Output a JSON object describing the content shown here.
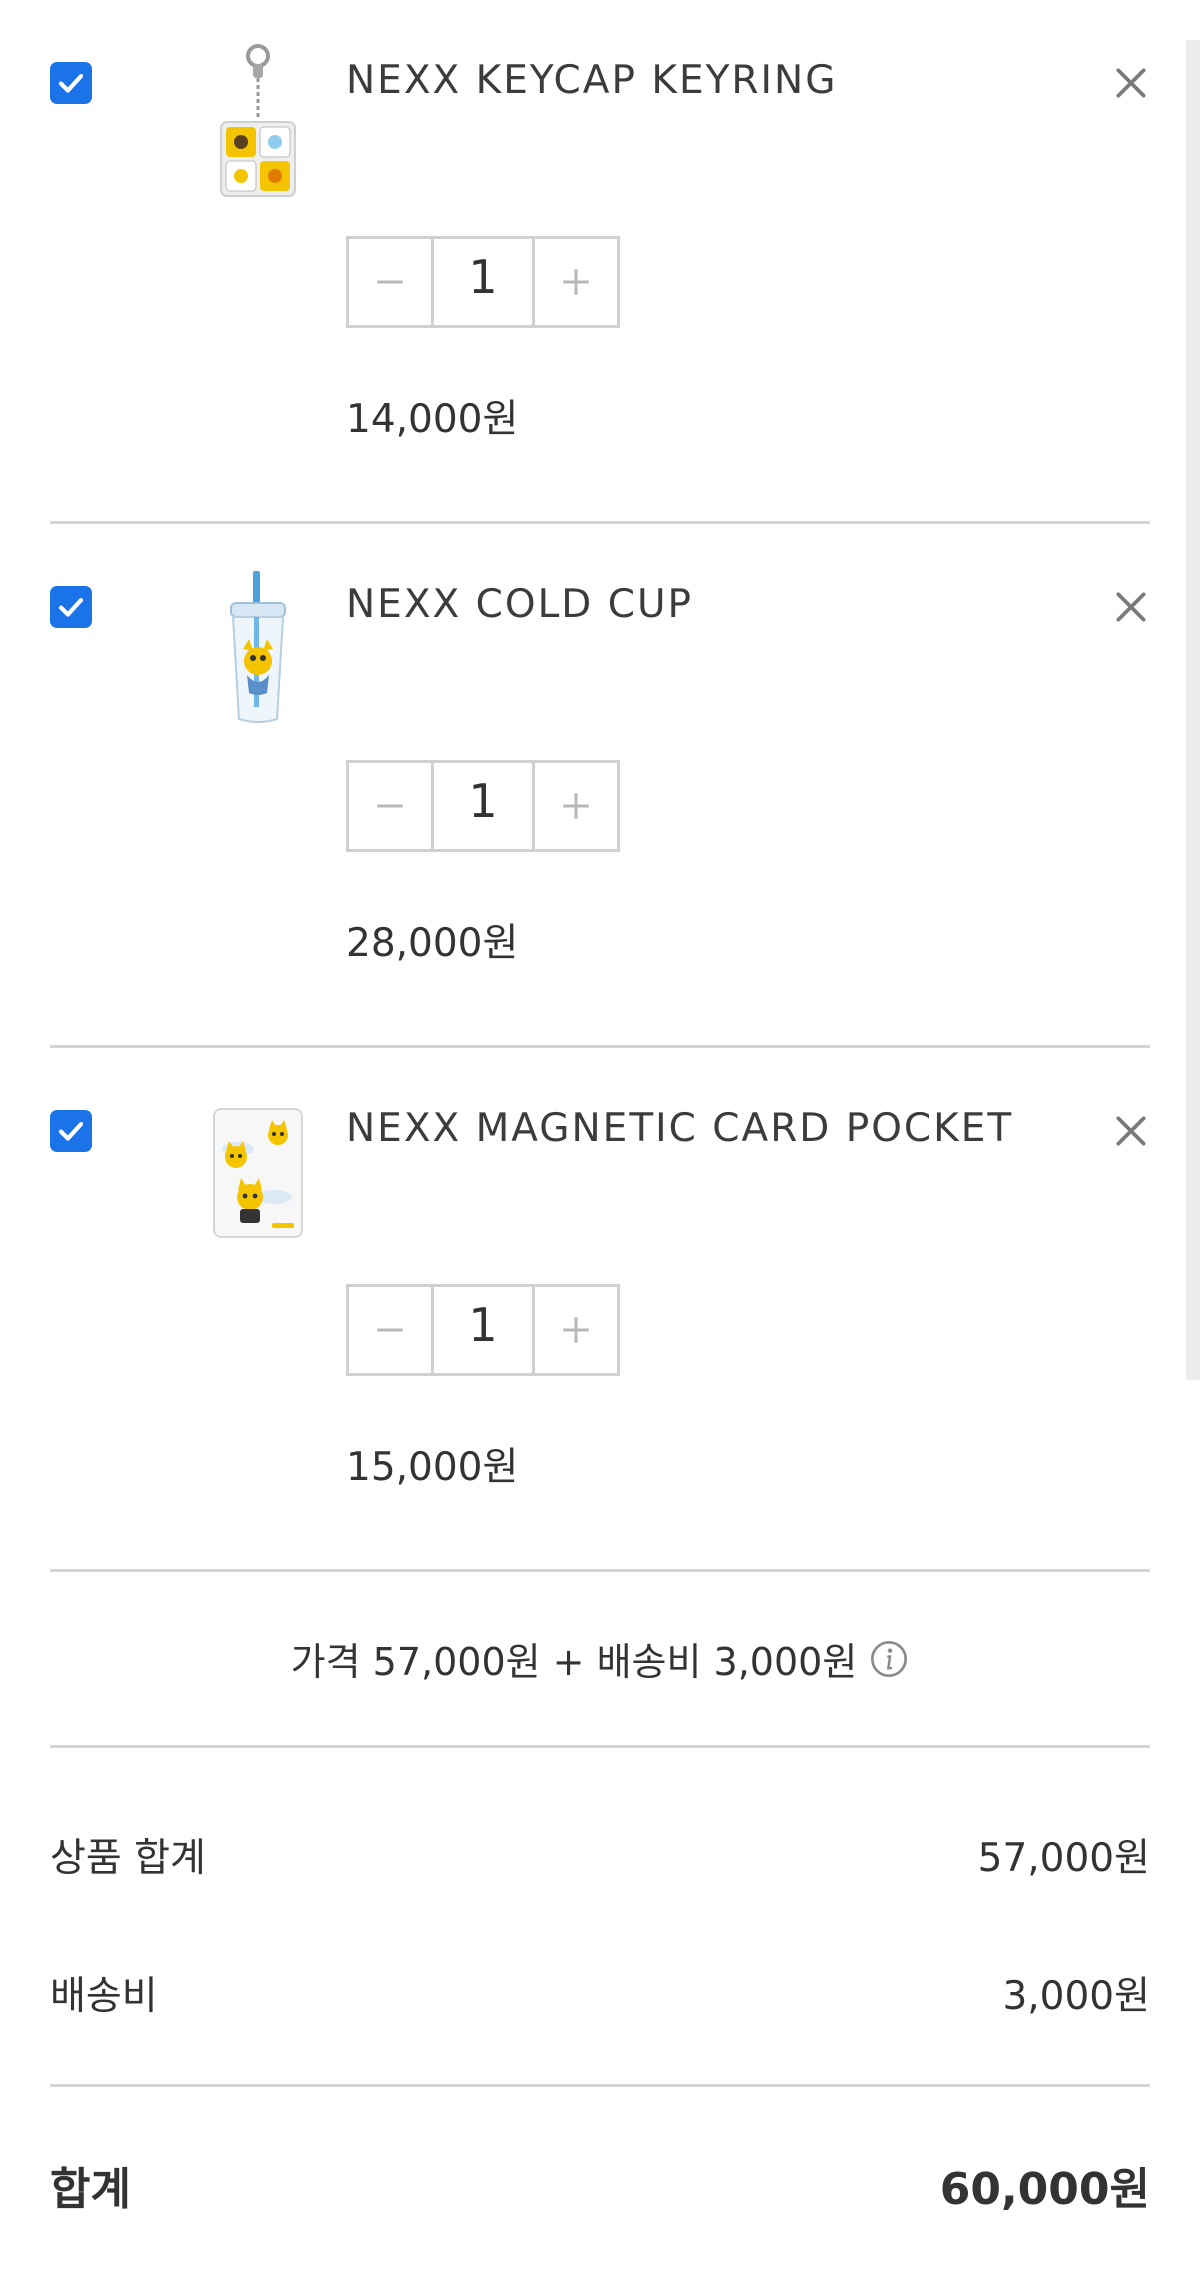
{
  "cart": {
    "items": [
      {
        "name": "NEXX KEYCAP KEYRING",
        "quantity": "1",
        "price": "14,000원",
        "checked": true,
        "thumbnail": "keyring-image"
      },
      {
        "name": "NEXX COLD CUP",
        "quantity": "1",
        "price": "28,000원",
        "checked": true,
        "thumbnail": "cold-cup-image"
      },
      {
        "name": "NEXX MAGNETIC CARD POCKET",
        "quantity": "1",
        "price": "15,000원",
        "checked": true,
        "thumbnail": "card-pocket-image"
      }
    ]
  },
  "summary": {
    "price_line": "가격 57,000원 + 배송비 3,000원",
    "subtotal_label": "상품 합계",
    "subtotal_value": "57,000원",
    "shipping_label": "배송비",
    "shipping_value": "3,000원",
    "total_label": "합계",
    "total_value": "60,000원"
  },
  "colors": {
    "checkbox": "#1a73e8",
    "divider": "#d4d4d4",
    "text": "#333333",
    "stepper_border": "#d0d0d0",
    "stepper_icon": "#b8b8b8",
    "remove_icon": "#7a7a7a"
  },
  "icons": {
    "check": "checkmark-icon",
    "remove": "close-icon",
    "decrease": "minus-icon",
    "increase": "plus-icon",
    "info": "info-icon"
  }
}
